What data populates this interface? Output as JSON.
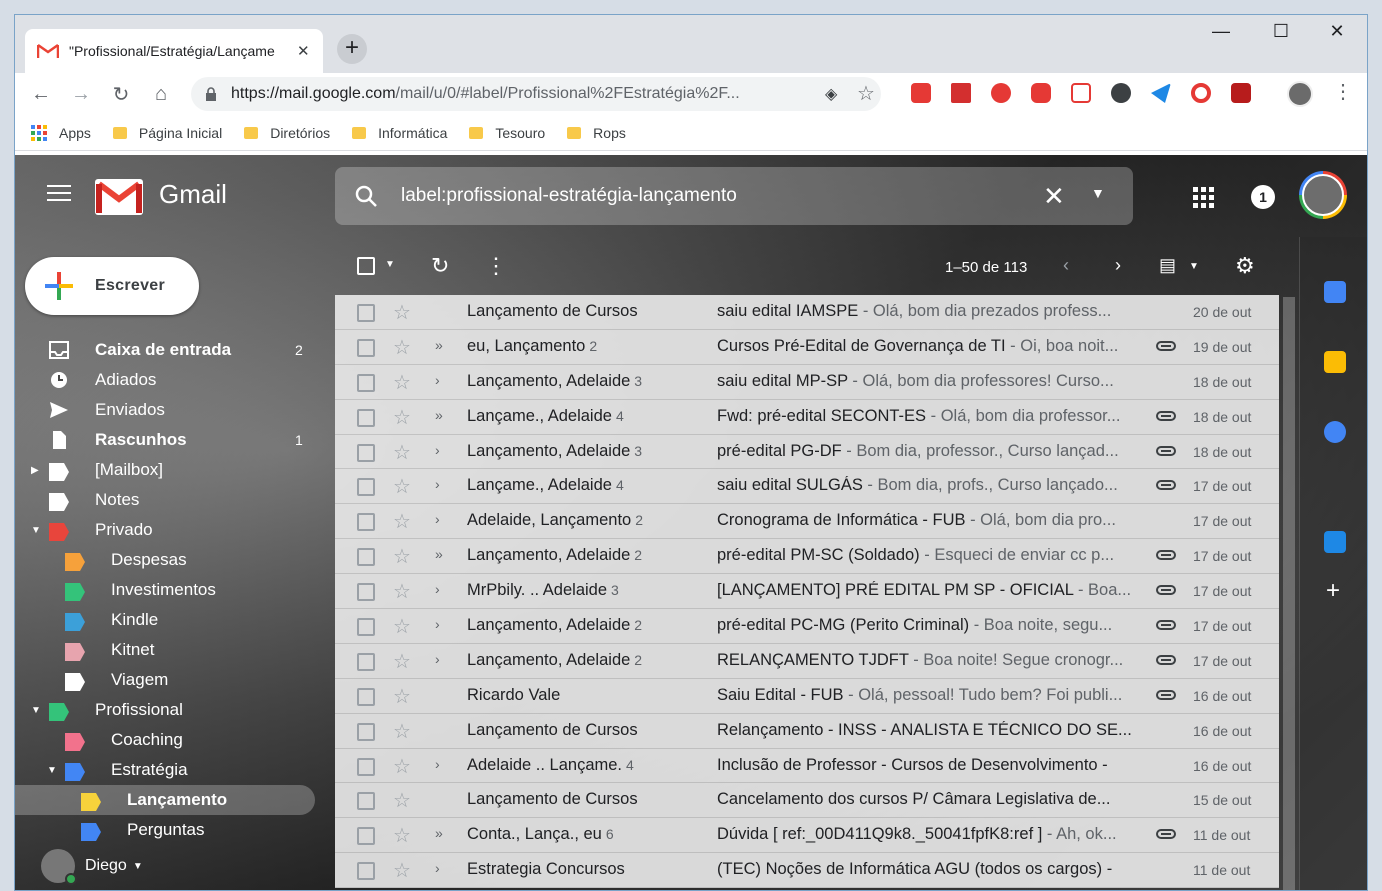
{
  "browser": {
    "tab_title": "\"Profissional/Estratégia/Lançame",
    "tab_close": "✕",
    "new_tab": "+",
    "url_main": "https://mail.google.com",
    "url_path": "/mail/u/0/#label/Profissional%2FEstratégia%2F...",
    "window_controls": {
      "minimize": "—",
      "maximize": "☐",
      "close": "✕"
    }
  },
  "bookmarks": [
    {
      "label": "Apps"
    },
    {
      "label": "Página Inicial"
    },
    {
      "label": "Diretórios"
    },
    {
      "label": "Informática"
    },
    {
      "label": "Tesouro"
    },
    {
      "label": "Rops"
    }
  ],
  "gmail": {
    "wordmark": "Gmail",
    "search_query": "label:profissional-estratégia-lançamento",
    "notification_count": "1",
    "compose_label": "Escrever",
    "page_info": "1–50 de 113",
    "user_name": "Diego"
  },
  "nav": [
    {
      "label": "Caixa de entrada",
      "count": "2",
      "bold": true
    },
    {
      "label": "Adiados",
      "count": ""
    },
    {
      "label": "Enviados",
      "count": ""
    },
    {
      "label": "Rascunhos",
      "count": "1",
      "bold": true
    },
    {
      "label": "[Mailbox]",
      "count": ""
    },
    {
      "label": "Notes",
      "count": ""
    },
    {
      "label": "Privado",
      "count": ""
    },
    {
      "label": "Despesas",
      "count": ""
    },
    {
      "label": "Investimentos",
      "count": ""
    },
    {
      "label": "Kindle",
      "count": ""
    },
    {
      "label": "Kitnet",
      "count": ""
    },
    {
      "label": "Viagem",
      "count": ""
    },
    {
      "label": "Profissional",
      "count": ""
    },
    {
      "label": "Coaching",
      "count": ""
    },
    {
      "label": "Estratégia",
      "count": ""
    },
    {
      "label": "Lançamento",
      "count": ""
    },
    {
      "label": "Perguntas",
      "count": ""
    }
  ],
  "label_colors": {
    "privado": "#e8453c",
    "despesas": "#f6a13b",
    "investimentos": "#34c37a",
    "kindle": "#3ca0d9",
    "kitnet": "#e7a4ae",
    "viagem": "#ffffff",
    "profissional": "#34c37a",
    "coaching": "#f2728c",
    "estrategia": "#4286f4",
    "lancamento": "#f7d23b",
    "perguntas": "#4286f4"
  },
  "messages": [
    {
      "sender": "Lançamento de Cursos",
      "count": "",
      "imp": "",
      "subject": "saiu edital IAMSPE",
      "snippet": " - Olá, bom dia prezados profess...",
      "attach": false,
      "date": "20 de out"
    },
    {
      "sender": "eu, Lançamento",
      "count": "2",
      "imp": "»",
      "subject": "Cursos Pré-Edital de Governança de TI",
      "snippet": " - Oi, boa noit...",
      "attach": true,
      "date": "19 de out"
    },
    {
      "sender": "Lançamento, Adelaide",
      "count": "3",
      "imp": "›",
      "subject": "saiu edital MP-SP",
      "snippet": " - Olá, bom dia professores! Curso...",
      "attach": false,
      "date": "18 de out"
    },
    {
      "sender": "Lançame., Adelaide",
      "count": "4",
      "imp": "»",
      "subject": "Fwd: pré-edital SECONT-ES",
      "snippet": " - Olá, bom dia professor...",
      "attach": true,
      "date": "18 de out"
    },
    {
      "sender": "Lançamento, Adelaide",
      "count": "3",
      "imp": "›",
      "subject": "pré-edital PG-DF",
      "snippet": " - Bom dia, professor., Curso lançad...",
      "attach": true,
      "date": "18 de out"
    },
    {
      "sender": "Lançame., Adelaide",
      "count": "4",
      "imp": "›",
      "subject": "saiu edital SULGÁS",
      "snippet": " - Bom dia, profs., Curso lançado...",
      "attach": true,
      "date": "17 de out"
    },
    {
      "sender": "Adelaide, Lançamento",
      "count": "2",
      "imp": "›",
      "subject": "Cronograma de Informática - FUB",
      "snippet": " - Olá, bom dia pro...",
      "attach": false,
      "date": "17 de out"
    },
    {
      "sender": "Lançamento, Adelaide",
      "count": "2",
      "imp": "»",
      "subject": "pré-edital PM-SC (Soldado)",
      "snippet": " - Esqueci de enviar cc p...",
      "attach": true,
      "date": "17 de out"
    },
    {
      "sender": "MrPbily. .. Adelaide",
      "count": "3",
      "imp": "›",
      "subject": "[LANÇAMENTO] PRÉ EDITAL PM SP - OFICIAL",
      "snippet": " - Boa...",
      "attach": true,
      "date": "17 de out"
    },
    {
      "sender": "Lançamento, Adelaide",
      "count": "2",
      "imp": "›",
      "subject": "pré-edital PC-MG (Perito Criminal)",
      "snippet": " - Boa noite, segu...",
      "attach": true,
      "date": "17 de out"
    },
    {
      "sender": "Lançamento, Adelaide",
      "count": "2",
      "imp": "›",
      "subject": "RELANÇAMENTO TJDFT",
      "snippet": " - Boa noite! Segue cronogr...",
      "attach": true,
      "date": "17 de out"
    },
    {
      "sender": "Ricardo Vale",
      "count": "",
      "imp": "",
      "subject": "Saiu Edital - FUB",
      "snippet": " - Olá, pessoal! Tudo bem? Foi publi...",
      "attach": true,
      "date": "16 de out"
    },
    {
      "sender": "Lançamento de Cursos",
      "count": "",
      "imp": "",
      "subject": "Relançamento - INSS - ANALISTA E TÉCNICO DO SE...",
      "snippet": "",
      "attach": false,
      "date": "16 de out"
    },
    {
      "sender": "Adelaide .. Lançame.",
      "count": "4",
      "imp": "›",
      "subject": "Inclusão de Professor - Cursos de Desenvolvimento -",
      "snippet": "",
      "attach": false,
      "date": "16 de out"
    },
    {
      "sender": "Lançamento de Cursos",
      "count": "",
      "imp": "",
      "subject": "Cancelamento dos cursos P/ Câmara Legislativa de...",
      "snippet": "",
      "attach": false,
      "date": "15 de out"
    },
    {
      "sender": "Conta., Lança., eu",
      "count": "6",
      "imp": "»",
      "subject": "Dúvida [ ref:_00D411Q9k8._50041fpfK8:ref ]",
      "snippet": " - Ah, ok...",
      "attach": true,
      "date": "11 de out"
    },
    {
      "sender": "Estrategia Concursos",
      "count": "",
      "imp": "›",
      "subject": "(TEC) Noções de Informática AGU (todos os cargos) -",
      "snippet": "",
      "attach": false,
      "date": "11 de out"
    }
  ]
}
